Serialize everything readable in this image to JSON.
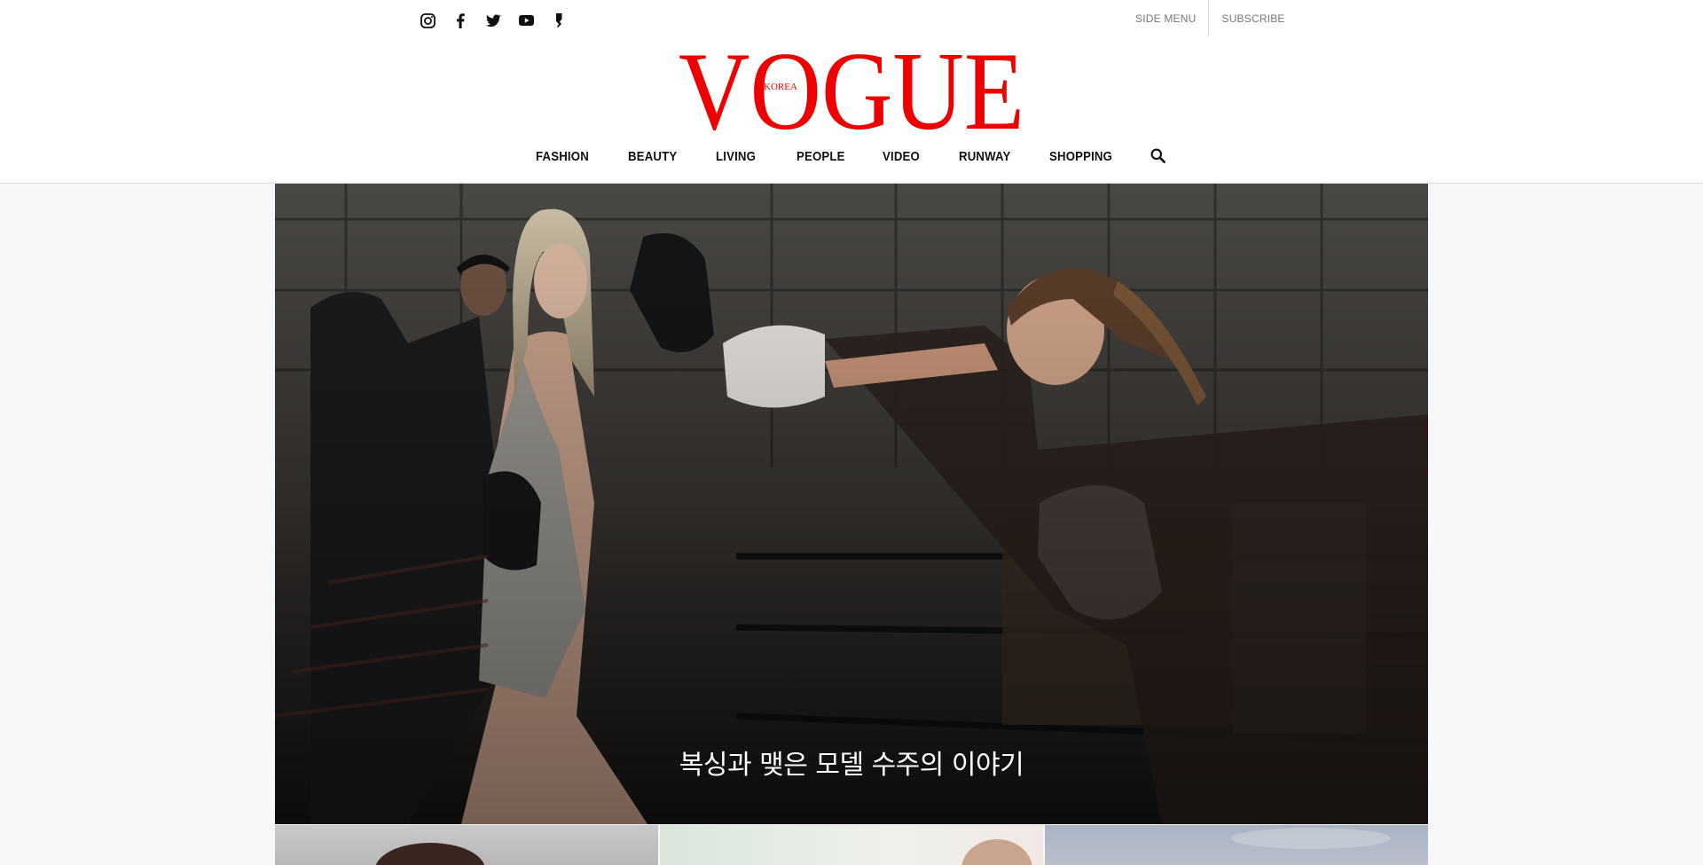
{
  "brand": {
    "logo_text": "VOGUE",
    "logo_subtext": "KOREA",
    "logo_color": "#ee0000"
  },
  "social_icons": [
    "instagram-icon",
    "facebook-icon",
    "twitter-icon",
    "youtube-icon",
    "kakao-story-icon"
  ],
  "top_links": {
    "side_menu": "SIDE MENU",
    "subscribe": "SUBSCRIBE"
  },
  "nav": {
    "items": [
      "FASHION",
      "BEAUTY",
      "LIVING",
      "PEOPLE",
      "VIDEO",
      "RUNWAY",
      "SHOPPING"
    ],
    "search_icon": "search-icon"
  },
  "hero": {
    "caption": "복싱과 맺은 모델 수주의 이야기"
  },
  "colors": {
    "page_bg": "#f7f7f7",
    "header_bg": "#ffffff",
    "nav_text": "#111111",
    "top_link_text": "#777777"
  }
}
